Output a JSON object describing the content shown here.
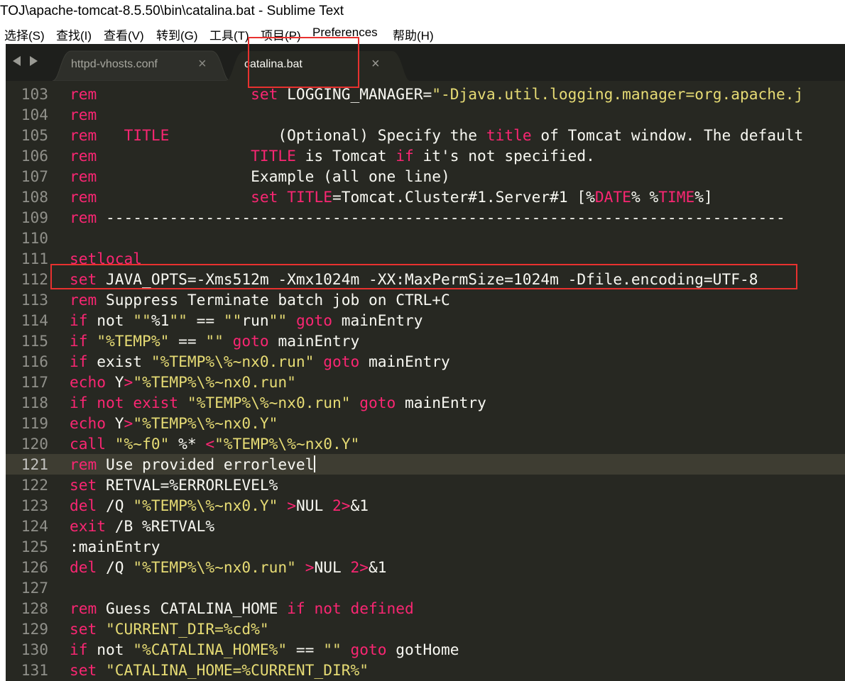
{
  "window": {
    "title": "TOJ\\apache-tomcat-8.5.50\\bin\\catalina.bat - Sublime Text"
  },
  "menu": [
    "选择(S)",
    "查找(I)",
    "查看(V)",
    "转到(G)",
    "工具(T)",
    "项目(P)",
    "Preferences",
    "帮助(H)"
  ],
  "tabs": [
    {
      "label": "httpd-vhosts.conf",
      "close": "×",
      "active": false
    },
    {
      "label": "catalina.bat",
      "close": "×",
      "active": true
    }
  ],
  "editor": {
    "current_line": "121",
    "highlighted_line": "112",
    "lines": [
      {
        "num": "103",
        "segs": [
          {
            "t": "rem",
            "c": "k"
          },
          {
            "t": "                 "
          },
          {
            "t": "set",
            "c": "k"
          },
          {
            "t": " LOGGING_MANAGER="
          },
          {
            "t": "\"-Djava.util.logging.manager=org.apache.j",
            "c": "s"
          }
        ]
      },
      {
        "num": "104",
        "segs": [
          {
            "t": "rem",
            "c": "k"
          }
        ]
      },
      {
        "num": "105",
        "segs": [
          {
            "t": "rem",
            "c": "k"
          },
          {
            "t": "   "
          },
          {
            "t": "TITLE",
            "c": "k"
          },
          {
            "t": "            (Optional) Specify the "
          },
          {
            "t": "title",
            "c": "k"
          },
          {
            "t": " of Tomcat window. The default"
          }
        ]
      },
      {
        "num": "106",
        "segs": [
          {
            "t": "rem",
            "c": "k"
          },
          {
            "t": "                 "
          },
          {
            "t": "TITLE",
            "c": "k"
          },
          {
            "t": " is Tomcat "
          },
          {
            "t": "if",
            "c": "k"
          },
          {
            "t": " it's not specified."
          }
        ]
      },
      {
        "num": "107",
        "segs": [
          {
            "t": "rem",
            "c": "k"
          },
          {
            "t": "                 Example (all one line)"
          }
        ]
      },
      {
        "num": "108",
        "segs": [
          {
            "t": "rem",
            "c": "k"
          },
          {
            "t": "                 "
          },
          {
            "t": "set",
            "c": "k"
          },
          {
            "t": " "
          },
          {
            "t": "TITLE",
            "c": "k"
          },
          {
            "t": "=Tomcat.Cluster#1.Server#1 [%"
          },
          {
            "t": "DATE",
            "c": "k"
          },
          {
            "t": "% %"
          },
          {
            "t": "TIME",
            "c": "k"
          },
          {
            "t": "%]"
          }
        ]
      },
      {
        "num": "109",
        "segs": [
          {
            "t": "rem",
            "c": "k"
          },
          {
            "t": " ---------------------------------------------------------------------------"
          }
        ]
      },
      {
        "num": "110",
        "segs": []
      },
      {
        "num": "111",
        "segs": [
          {
            "t": "setlocal",
            "c": "k"
          }
        ]
      },
      {
        "num": "112",
        "segs": [
          {
            "t": "set",
            "c": "k"
          },
          {
            "t": " JAVA_OPTS=-Xms512m -Xmx1024m -XX:MaxPermSize=1024m -Dfile.encoding=UTF-8"
          }
        ]
      },
      {
        "num": "113",
        "segs": [
          {
            "t": "rem",
            "c": "k"
          },
          {
            "t": " Suppress Terminate batch job on CTRL+C"
          }
        ]
      },
      {
        "num": "114",
        "segs": [
          {
            "t": "if",
            "c": "k"
          },
          {
            "t": " not "
          },
          {
            "t": "\"\"",
            "c": "s"
          },
          {
            "t": "%1"
          },
          {
            "t": "\"\"",
            "c": "s"
          },
          {
            "t": " == "
          },
          {
            "t": "\"\"",
            "c": "s"
          },
          {
            "t": "run"
          },
          {
            "t": "\"\"",
            "c": "s"
          },
          {
            "t": " "
          },
          {
            "t": "goto",
            "c": "k"
          },
          {
            "t": " mainEntry"
          }
        ]
      },
      {
        "num": "115",
        "segs": [
          {
            "t": "if",
            "c": "k"
          },
          {
            "t": " "
          },
          {
            "t": "\"%TEMP%\"",
            "c": "s"
          },
          {
            "t": " == "
          },
          {
            "t": "\"\"",
            "c": "s"
          },
          {
            "t": " "
          },
          {
            "t": "goto",
            "c": "k"
          },
          {
            "t": " mainEntry"
          }
        ]
      },
      {
        "num": "116",
        "segs": [
          {
            "t": "if",
            "c": "k"
          },
          {
            "t": " exist "
          },
          {
            "t": "\"%TEMP%\\%~nx0.run\"",
            "c": "s"
          },
          {
            "t": " "
          },
          {
            "t": "goto",
            "c": "k"
          },
          {
            "t": " mainEntry"
          }
        ]
      },
      {
        "num": "117",
        "segs": [
          {
            "t": "echo",
            "c": "k"
          },
          {
            "t": " Y"
          },
          {
            "t": ">",
            "c": "k"
          },
          {
            "t": "\"%TEMP%\\%~nx0.run\"",
            "c": "s"
          }
        ]
      },
      {
        "num": "118",
        "segs": [
          {
            "t": "if",
            "c": "k"
          },
          {
            "t": " "
          },
          {
            "t": "not",
            "c": "k"
          },
          {
            "t": " "
          },
          {
            "t": "exist",
            "c": "k"
          },
          {
            "t": " "
          },
          {
            "t": "\"%TEMP%\\%~nx0.run\"",
            "c": "s"
          },
          {
            "t": " "
          },
          {
            "t": "goto",
            "c": "k"
          },
          {
            "t": " mainEntry"
          }
        ]
      },
      {
        "num": "119",
        "segs": [
          {
            "t": "echo",
            "c": "k"
          },
          {
            "t": " Y"
          },
          {
            "t": ">",
            "c": "k"
          },
          {
            "t": "\"%TEMP%\\%~nx0.Y\"",
            "c": "s"
          }
        ]
      },
      {
        "num": "120",
        "segs": [
          {
            "t": "call",
            "c": "k"
          },
          {
            "t": " "
          },
          {
            "t": "\"%~f0\"",
            "c": "s"
          },
          {
            "t": " %* "
          },
          {
            "t": "<",
            "c": "k"
          },
          {
            "t": "\"%TEMP%\\%~nx0.Y\"",
            "c": "s"
          }
        ]
      },
      {
        "num": "121",
        "segs": [
          {
            "t": "rem",
            "c": "k"
          },
          {
            "t": " Use provided errorlevel"
          }
        ]
      },
      {
        "num": "122",
        "segs": [
          {
            "t": "set",
            "c": "k"
          },
          {
            "t": " RETVAL=%ERRORLEVEL%"
          }
        ]
      },
      {
        "num": "123",
        "segs": [
          {
            "t": "del",
            "c": "k"
          },
          {
            "t": " /Q "
          },
          {
            "t": "\"%TEMP%\\%~nx0.Y\"",
            "c": "s"
          },
          {
            "t": " "
          },
          {
            "t": ">",
            "c": "k"
          },
          {
            "t": "NUL "
          },
          {
            "t": "2>",
            "c": "k"
          },
          {
            "t": "&1"
          }
        ]
      },
      {
        "num": "124",
        "segs": [
          {
            "t": "exit",
            "c": "k"
          },
          {
            "t": " /B %RETVAL%"
          }
        ]
      },
      {
        "num": "125",
        "segs": [
          {
            "t": ":mainEntry"
          }
        ]
      },
      {
        "num": "126",
        "segs": [
          {
            "t": "del",
            "c": "k"
          },
          {
            "t": " /Q "
          },
          {
            "t": "\"%TEMP%\\%~nx0.run\"",
            "c": "s"
          },
          {
            "t": " "
          },
          {
            "t": ">",
            "c": "k"
          },
          {
            "t": "NUL "
          },
          {
            "t": "2>",
            "c": "k"
          },
          {
            "t": "&1"
          }
        ]
      },
      {
        "num": "127",
        "segs": []
      },
      {
        "num": "128",
        "segs": [
          {
            "t": "rem",
            "c": "k"
          },
          {
            "t": " Guess CATALINA_HOME "
          },
          {
            "t": "if",
            "c": "k"
          },
          {
            "t": " "
          },
          {
            "t": "not",
            "c": "k"
          },
          {
            "t": " "
          },
          {
            "t": "defined",
            "c": "k"
          }
        ]
      },
      {
        "num": "129",
        "segs": [
          {
            "t": "set",
            "c": "k"
          },
          {
            "t": " "
          },
          {
            "t": "\"CURRENT_DIR=%cd%\"",
            "c": "s"
          }
        ]
      },
      {
        "num": "130",
        "segs": [
          {
            "t": "if",
            "c": "k"
          },
          {
            "t": " not "
          },
          {
            "t": "\"%CATALINA_HOME%\"",
            "c": "s"
          },
          {
            "t": " == "
          },
          {
            "t": "\"\"",
            "c": "s"
          },
          {
            "t": " "
          },
          {
            "t": "goto",
            "c": "k"
          },
          {
            "t": " gotHome"
          }
        ]
      },
      {
        "num": "131",
        "segs": [
          {
            "t": "set",
            "c": "k"
          },
          {
            "t": " "
          },
          {
            "t": "\"CATALINA_HOME=%CURRENT_DIR%\"",
            "c": "s"
          }
        ]
      }
    ]
  },
  "colors": {
    "background": "#272822",
    "keyword": "#f92672",
    "string": "#e6db74",
    "text": "#f8f8f2",
    "line_number": "#90908a",
    "annotation_box": "#e8312f"
  }
}
